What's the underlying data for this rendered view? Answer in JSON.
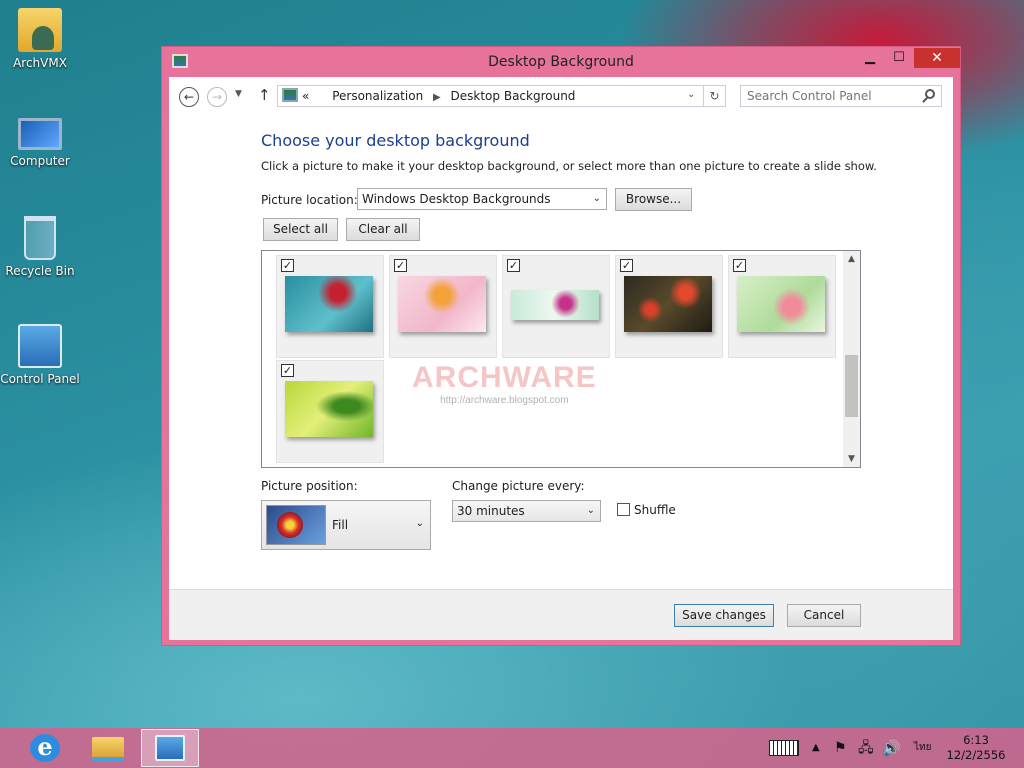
{
  "desktop": {
    "icons": [
      {
        "label": "ArchVMX",
        "icon": "user-folder-icon"
      },
      {
        "label": "Computer",
        "icon": "computer-icon"
      },
      {
        "label": "Recycle Bin",
        "icon": "recycle-bin-icon"
      },
      {
        "label": "Control Panel",
        "icon": "control-panel-icon"
      }
    ]
  },
  "window": {
    "title": "Desktop Background",
    "controls": {
      "minimize": "▁",
      "maximize": "☐",
      "close": "✕"
    },
    "navigation": {
      "back_icon": "back-arrow-icon",
      "forward_icon": "forward-arrow-icon",
      "breadcrumb_prefix": "«",
      "breadcrumb": [
        "Personalization",
        "Desktop Background"
      ],
      "search_placeholder": "Search Control Panel"
    },
    "heading": "Choose your desktop background",
    "description": "Click a picture to make it your desktop background, or select more than one picture to create a slide show.",
    "picture_location": {
      "label": "Picture location:",
      "value": "Windows Desktop Backgrounds",
      "browse_label": "Browse..."
    },
    "select_all_label": "Select all",
    "clear_all_label": "Clear all",
    "gallery": {
      "check_mark": "✓",
      "pictures": [
        {
          "checked": true,
          "desc": "red flower teal"
        },
        {
          "checked": true,
          "desc": "orange lily pink"
        },
        {
          "checked": true,
          "desc": "pink flower mint"
        },
        {
          "checked": true,
          "desc": "red tulips dark"
        },
        {
          "checked": true,
          "desc": "pink lily green"
        },
        {
          "checked": true,
          "desc": "green leaves"
        }
      ]
    },
    "watermark": {
      "text": "ARCHWARE",
      "url": "http://archware.blogspot.com"
    },
    "picture_position": {
      "label": "Picture position:",
      "value": "Fill"
    },
    "change_every": {
      "label": "Change picture every:",
      "value": "30 minutes"
    },
    "shuffle": {
      "label": "Shuffle",
      "checked": false
    },
    "save_label": "Save changes",
    "cancel_label": "Cancel"
  },
  "taskbar": {
    "items": [
      {
        "name": "internet-explorer",
        "icon": "ie-icon"
      },
      {
        "name": "file-explorer",
        "icon": "folder-icon"
      },
      {
        "name": "control-panel",
        "icon": "control-panel-icon",
        "active": true
      }
    ],
    "tray": {
      "language": "ไทย",
      "time": "6:13",
      "date": "12/2/2556"
    }
  },
  "colors": {
    "window_frame": "#e8739a",
    "heading": "#1a3f8e",
    "close_button": "#c7312e"
  }
}
